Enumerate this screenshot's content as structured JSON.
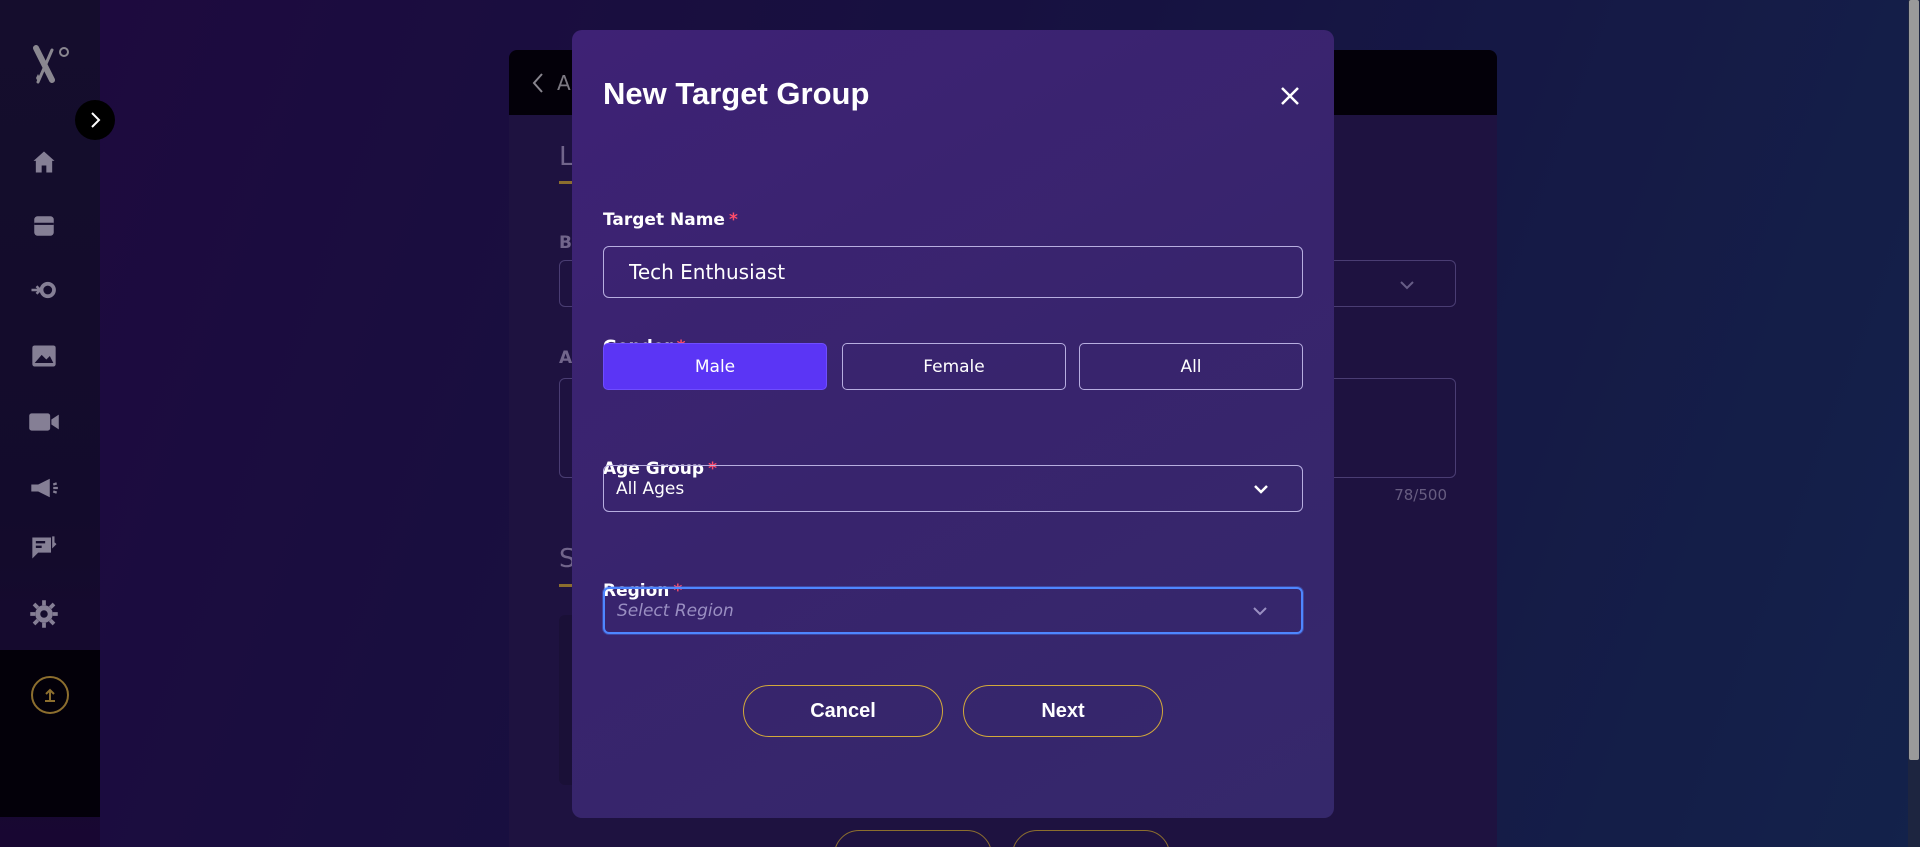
{
  "background": {
    "topbar_text": "A",
    "section_letter_1": "L",
    "label_b": "B",
    "label_a": "A",
    "section_letter_2": "S",
    "counter": "78/500"
  },
  "modal": {
    "title": "New Target Group",
    "target_name": {
      "label": "Target Name",
      "required_mark": "*",
      "value": "Tech Enthusiast"
    },
    "gender": {
      "label": "Gender",
      "required_mark": "*",
      "options": [
        "Male",
        "Female",
        "All"
      ],
      "selected": "Male"
    },
    "age_group": {
      "label": "Age Group",
      "required_mark": "*",
      "value": "All Ages"
    },
    "region": {
      "label": "Region",
      "required_mark": "*",
      "placeholder": "Select Region"
    },
    "cancel_label": "Cancel",
    "next_label": "Next"
  },
  "colors": {
    "accent": "#5b35f5",
    "gold": "#d3a93a",
    "required": "#ff4d6a",
    "focus": "#4e86ff"
  },
  "icons": [
    "logo-icon",
    "chevron-right-icon",
    "home-icon",
    "archive-icon",
    "gear-arrow-icon",
    "image-icon",
    "video-icon",
    "megaphone-icon",
    "task-icon",
    "settings-icon",
    "upload-icon",
    "close-icon",
    "chevron-down-icon"
  ]
}
